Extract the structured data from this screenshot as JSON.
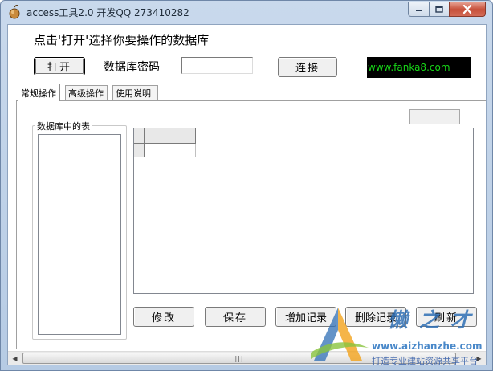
{
  "window": {
    "title": "access工具2.0 开发QQ 273410282",
    "controls": {
      "minimize": "minimize",
      "maximize": "maximize",
      "close": "close"
    }
  },
  "header": {
    "instruction": "点击'打开'选择你要操作的数据库",
    "open_button": "打开",
    "password_label": "数据库密码",
    "password_value": "",
    "connect_button": "连接",
    "site_url": "www.fanka8.com"
  },
  "tabs": [
    {
      "label": "常规操作",
      "active": true
    },
    {
      "label": "高级操作",
      "active": false
    },
    {
      "label": "使用说明",
      "active": false
    }
  ],
  "tables_panel": {
    "title": "数据库中的表",
    "items": []
  },
  "grid": {
    "columns": [
      ""
    ],
    "rows": [
      [
        ""
      ]
    ]
  },
  "actions": {
    "edit": "修改",
    "save": "保存",
    "add": "增加记录",
    "delete": "删除记录",
    "refresh": "刷新"
  },
  "scrollbar": {
    "thumb_grip": "|||"
  },
  "watermark": {
    "title": "懒之才",
    "url": "www.aizhanzhe.com",
    "slogan": "打造专业建站资源共享平台",
    "colors": {
      "blue": "#2f6fb5",
      "orange": "#f3a21b",
      "green": "#8ac43f"
    }
  },
  "colors": {
    "url_bg": "#000000",
    "url_text": "#17d617",
    "close_button": "#c7503a"
  }
}
